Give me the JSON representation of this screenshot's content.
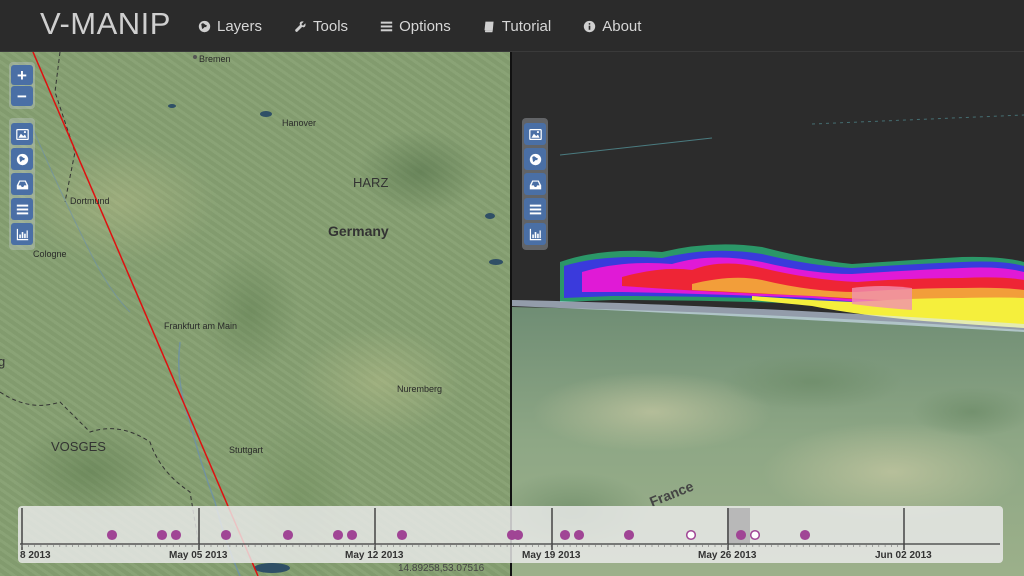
{
  "app": {
    "title": "V-MANIP"
  },
  "nav": {
    "items": [
      {
        "label": "Layers",
        "icon": "globe-icon"
      },
      {
        "label": "Tools",
        "icon": "wrench-icon"
      },
      {
        "label": "Options",
        "icon": "options-icon"
      },
      {
        "label": "Tutorial",
        "icon": "book-icon"
      },
      {
        "label": "About",
        "icon": "info-icon"
      }
    ]
  },
  "map2d": {
    "labels": {
      "bremen": "Bremen",
      "hanover": "Hanover",
      "harz": "HARZ",
      "dortmund": "Dortmund",
      "germany": "Germany",
      "cologne": "Cologne",
      "frankfurt": "Frankfurt am Main",
      "nuremberg": "Nuremberg",
      "vosges": "VOSGES",
      "stuttgart": "Stuttgart",
      "edge_g": "g"
    },
    "zoom_in": "+",
    "zoom_out": "−",
    "controls": [
      "image-icon",
      "globe-icon",
      "inbox-icon",
      "list-icon",
      "chart-icon"
    ],
    "track_color": "#e01010"
  },
  "map3d": {
    "labels": {
      "france": "France"
    },
    "controls": [
      "image-icon",
      "globe-icon",
      "inbox-icon",
      "list-icon",
      "chart-icon"
    ]
  },
  "timeline": {
    "date_labels": [
      "8 2013",
      "May 05 2013",
      "May 12 2013",
      "May 19 2013",
      "May 26 2013",
      "Jun 02 2013"
    ],
    "event_color": "#a04595",
    "selected_range_color": "#b8b8b8"
  },
  "coordinates": {
    "text": "14.89258,53.07516"
  }
}
